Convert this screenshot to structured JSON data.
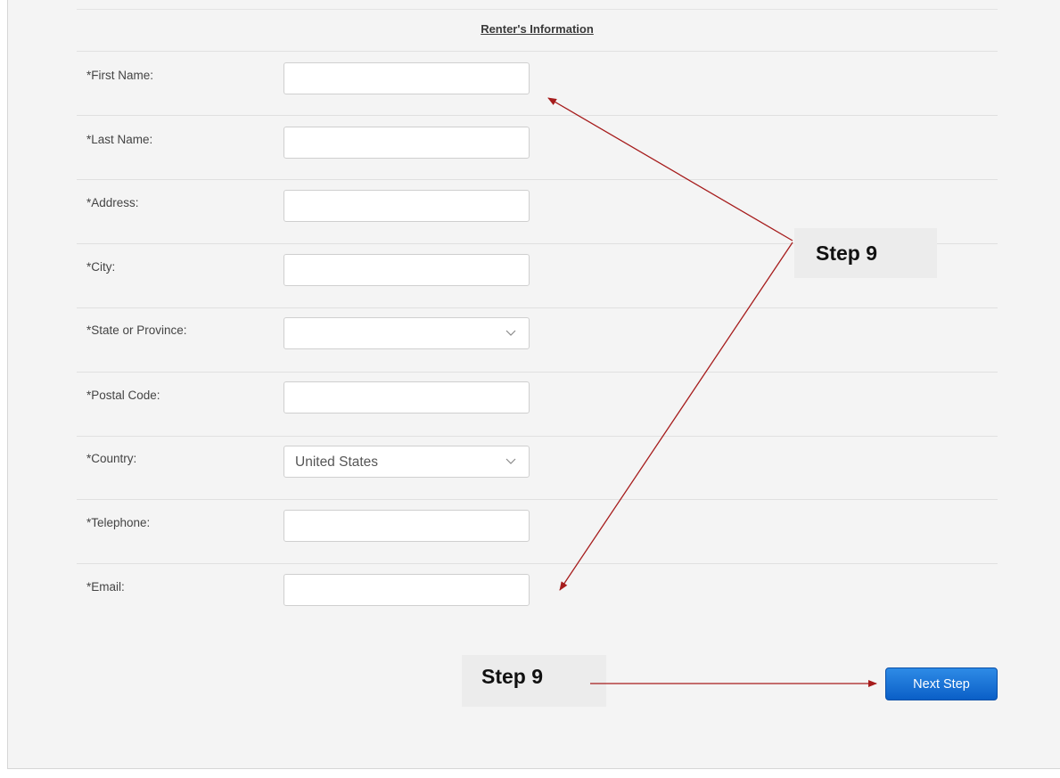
{
  "section_title": "Renter's Information",
  "fields": {
    "first_name": {
      "label": "*First Name:",
      "value": ""
    },
    "last_name": {
      "label": "*Last Name:",
      "value": ""
    },
    "address": {
      "label": "*Address:",
      "value": ""
    },
    "city": {
      "label": "*City:",
      "value": ""
    },
    "state": {
      "label": "*State or Province:",
      "value": ""
    },
    "postal_code": {
      "label": "*Postal Code:",
      "value": ""
    },
    "country": {
      "label": "*Country:",
      "value": "United States"
    },
    "telephone": {
      "label": "*Telephone:",
      "value": ""
    },
    "email": {
      "label": "*Email:",
      "value": ""
    }
  },
  "next_button": {
    "label": "Next Step",
    "color": "#0a64cf"
  },
  "annotations": {
    "callout_fields": "Step 9",
    "callout_button": "Step 9",
    "arrow_color": "#a61c1c"
  }
}
